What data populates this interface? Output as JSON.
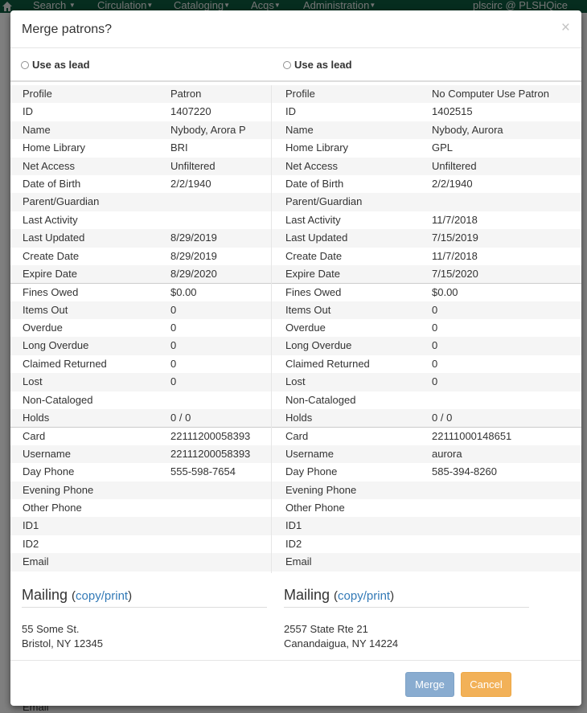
{
  "navbar": {
    "items": [
      "Search",
      "Circulation",
      "Cataloging",
      "Acqs",
      "Administration"
    ],
    "user": "plscirc @ PLSHQice"
  },
  "background": {
    "partial_text": "Email"
  },
  "modal": {
    "title": "Merge patrons?",
    "close": "×",
    "lead_label": "Use as lead",
    "patrons": [
      {
        "rows": [
          {
            "label": "Profile",
            "value": "Patron"
          },
          {
            "label": "ID",
            "value": "1407220"
          },
          {
            "label": "Name",
            "value": "Nybody, Arora P"
          },
          {
            "label": "Home Library",
            "value": "BRI"
          },
          {
            "label": "Net Access",
            "value": "Unfiltered"
          },
          {
            "label": "Date of Birth",
            "value": "2/2/1940"
          },
          {
            "label": "Parent/Guardian",
            "value": ""
          },
          {
            "label": "Last Activity",
            "value": ""
          },
          {
            "label": "Last Updated",
            "value": "8/29/2019"
          },
          {
            "label": "Create Date",
            "value": "8/29/2019"
          },
          {
            "label": "Expire Date",
            "value": "8/29/2020"
          },
          {
            "label": "Fines Owed",
            "value": "$0.00"
          },
          {
            "label": "Items Out",
            "value": "0"
          },
          {
            "label": "Overdue",
            "value": "0"
          },
          {
            "label": "Long Overdue",
            "value": "0"
          },
          {
            "label": "Claimed Returned",
            "value": "0"
          },
          {
            "label": "Lost",
            "value": "0"
          },
          {
            "label": "Non-Cataloged",
            "value": ""
          },
          {
            "label": "Holds",
            "value": "0 / 0"
          },
          {
            "label": "Card",
            "value": "22111200058393"
          },
          {
            "label": "Username",
            "value": "22111200058393"
          },
          {
            "label": "Day Phone",
            "value": "555-598-7654"
          },
          {
            "label": "Evening Phone",
            "value": ""
          },
          {
            "label": "Other Phone",
            "value": ""
          },
          {
            "label": "ID1",
            "value": ""
          },
          {
            "label": "ID2",
            "value": ""
          },
          {
            "label": "Email",
            "value": ""
          }
        ],
        "mailing_heading": "Mailing",
        "mailing_link": "copy/print",
        "address_line1": "55 Some St.",
        "address_line2": "Bristol, NY 12345"
      },
      {
        "rows": [
          {
            "label": "Profile",
            "value": "No Computer Use Patron"
          },
          {
            "label": "ID",
            "value": "1402515"
          },
          {
            "label": "Name",
            "value": "Nybody, Aurora"
          },
          {
            "label": "Home Library",
            "value": "GPL"
          },
          {
            "label": "Net Access",
            "value": "Unfiltered"
          },
          {
            "label": "Date of Birth",
            "value": "2/2/1940"
          },
          {
            "label": "Parent/Guardian",
            "value": ""
          },
          {
            "label": "Last Activity",
            "value": "11/7/2018"
          },
          {
            "label": "Last Updated",
            "value": "7/15/2019"
          },
          {
            "label": "Create Date",
            "value": "11/7/2018"
          },
          {
            "label": "Expire Date",
            "value": "7/15/2020"
          },
          {
            "label": "Fines Owed",
            "value": "$0.00"
          },
          {
            "label": "Items Out",
            "value": "0"
          },
          {
            "label": "Overdue",
            "value": "0"
          },
          {
            "label": "Long Overdue",
            "value": "0"
          },
          {
            "label": "Claimed Returned",
            "value": "0"
          },
          {
            "label": "Lost",
            "value": "0"
          },
          {
            "label": "Non-Cataloged",
            "value": ""
          },
          {
            "label": "Holds",
            "value": "0 / 0"
          },
          {
            "label": "Card",
            "value": "22111000148651"
          },
          {
            "label": "Username",
            "value": "aurora"
          },
          {
            "label": "Day Phone",
            "value": "585-394-8260"
          },
          {
            "label": "Evening Phone",
            "value": ""
          },
          {
            "label": "Other Phone",
            "value": ""
          },
          {
            "label": "ID1",
            "value": ""
          },
          {
            "label": "ID2",
            "value": ""
          },
          {
            "label": "Email",
            "value": ""
          }
        ],
        "mailing_heading": "Mailing",
        "mailing_link": "copy/print",
        "address_line1": "2557 State Rte 21",
        "address_line2": "Canandaigua, NY 14224"
      }
    ],
    "buttons": {
      "merge": "Merge",
      "cancel": "Cancel"
    }
  }
}
